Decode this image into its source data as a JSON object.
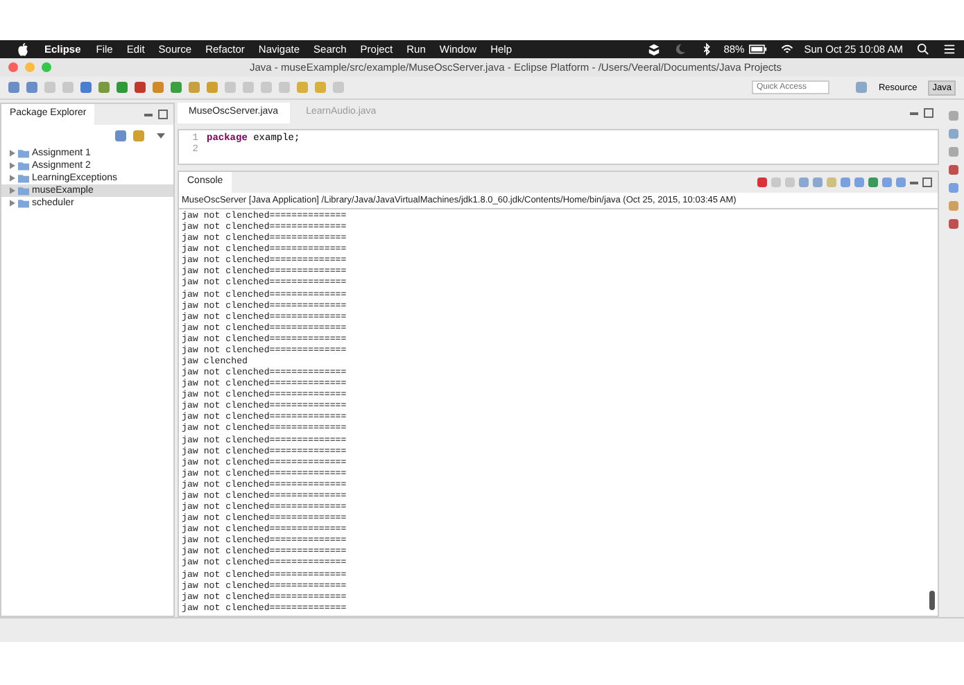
{
  "menubar": {
    "app": "Eclipse",
    "menus": [
      "File",
      "Edit",
      "Source",
      "Refactor",
      "Navigate",
      "Search",
      "Project",
      "Run",
      "Window",
      "Help"
    ],
    "battery": "88%",
    "clock": "Sun Oct 25  10:08 AM"
  },
  "window": {
    "title": "Java - museExample/src/example/MuseOscServer.java - Eclipse Platform - /Users/Veeral/Documents/Java Projects"
  },
  "toolbar": {
    "quick_access": {
      "placeholder": "Quick Access"
    },
    "perspectives": [
      {
        "label": "Resource",
        "selected": false
      },
      {
        "label": "Java",
        "selected": true
      }
    ]
  },
  "package_explorer": {
    "title": "Package Explorer",
    "projects": [
      {
        "name": "Assignment 1",
        "selected": false
      },
      {
        "name": "Assignment 2",
        "selected": false
      },
      {
        "name": "LearningExceptions",
        "selected": false
      },
      {
        "name": "museExample",
        "selected": true
      },
      {
        "name": "scheduler",
        "selected": false
      }
    ]
  },
  "editor": {
    "tabs": [
      {
        "label": "MuseOscServer.java",
        "selected": true
      },
      {
        "label": "LearnAudio.java",
        "selected": false
      }
    ],
    "lines": [
      {
        "number": "1",
        "code": "**package** example;"
      },
      {
        "number": "2"
      }
    ]
  },
  "console": {
    "title": "Console",
    "launch": "MuseOscServer [Java Application] /Library/Java/JavaVirtualMachines/jdk1.8.0_60.jdk/Contents/Home/bin/java (Oct 25, 2015, 10:03:45 AM)",
    "lines": [
      "jaw not clenched==============",
      "jaw not clenched==============",
      "jaw not clenched==============",
      "jaw not clenched==============",
      "jaw not clenched==============",
      "jaw not clenched==============",
      "jaw not clenched==============",
      "jaw not clenched==============",
      "jaw not clenched==============",
      "jaw not clenched==============",
      "jaw not clenched==============",
      "jaw not clenched==============",
      "jaw not clenched==============",
      "jaw clenched",
      "jaw not clenched==============",
      "jaw not clenched==============",
      "jaw not clenched==============",
      "jaw not clenched==============",
      "jaw not clenched==============",
      "jaw not clenched==============",
      "jaw not clenched==============",
      "jaw not clenched==============",
      "jaw not clenched==============",
      "jaw not clenched==============",
      "jaw not clenched==============",
      "jaw not clenched==============",
      "jaw not clenched==============",
      "jaw not clenched==============",
      "jaw not clenched==============",
      "jaw not clenched==============",
      "jaw not clenched==============",
      "jaw not clenched==============",
      "jaw not clenched==============",
      "jaw not clenched==============",
      "jaw not clenched==============",
      "jaw not clenched=============="
    ]
  }
}
